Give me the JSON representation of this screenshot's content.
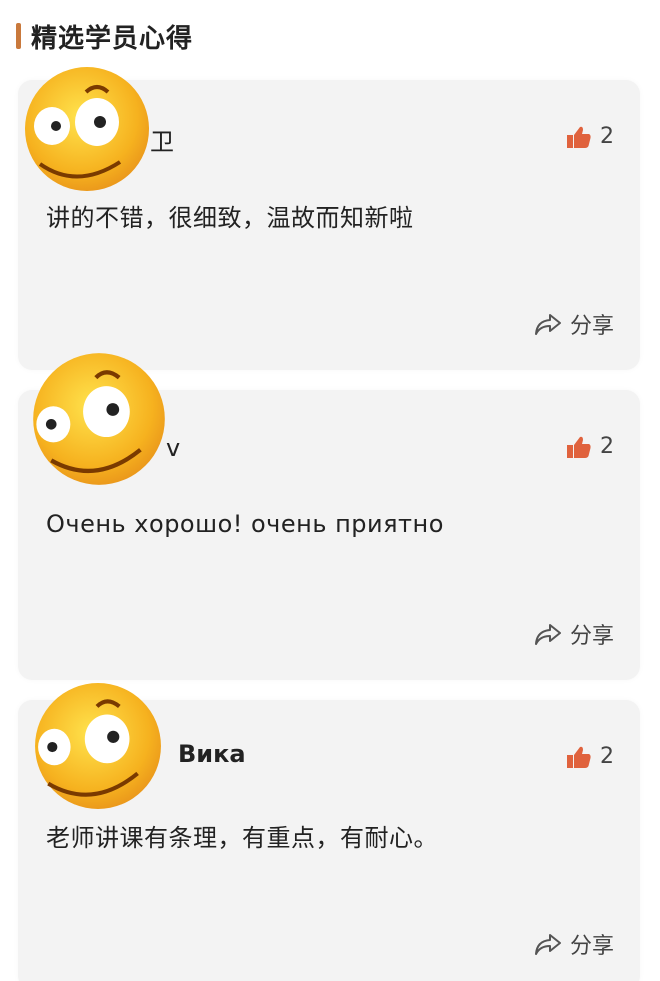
{
  "section": {
    "title": "精选学员心得"
  },
  "reviews": [
    {
      "username": "卫",
      "likes": "2",
      "comment": "讲的不错，很细致，温故而知新啦",
      "share_label": "分享"
    },
    {
      "username": "v",
      "likes": "2",
      "comment": "Очень хорошо! очень приятно",
      "share_label": "分享"
    },
    {
      "username": "Вика",
      "likes": "2",
      "comment": "老师讲课有条理，有重点，有耐心。",
      "share_label": "分享"
    }
  ],
  "colors": {
    "accent": "#c9793c",
    "like_icon": "#e0623d",
    "card_bg": "#f3f3f3",
    "emoji_face": "#f6b21f"
  },
  "icons": {
    "like": "thumbs-up-icon",
    "share": "share-arrow-icon",
    "avatar": "emoji-face-avatar"
  }
}
